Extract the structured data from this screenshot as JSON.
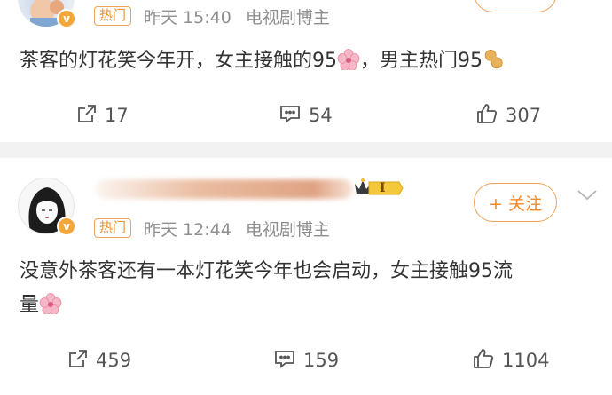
{
  "posts": [
    {
      "tag": "热门",
      "time": "昨天 15:40",
      "source": "电视剧博主",
      "follow_label": "",
      "content": "茶客的灯花笑今年开，女主接触的95",
      "content_mid": "，男主热门95",
      "repost_count": "17",
      "comment_count": "54",
      "like_count": "307"
    },
    {
      "tag": "热门",
      "time": "昨天 12:44",
      "source": "电视剧博主",
      "follow_label": "+ 关注",
      "level_label": "I",
      "content_line1": "没意外茶客还有一本灯花笑今年也会启动，女主接触95流",
      "content_line2": "量",
      "repost_count": "459",
      "comment_count": "159",
      "like_count": "1104"
    }
  ],
  "icons": {
    "verified": "verified-badge-icon",
    "repost": "repost-icon",
    "comment": "comment-icon",
    "like": "thumbs-up-icon",
    "flower": "cherry-blossom-emoji",
    "peanut": "peanut-emoji",
    "crown": "crown-level-icon",
    "chevron": "chevron-down-icon"
  },
  "colors": {
    "accent": "#f08a2a",
    "hot_tag": "#e8912f",
    "meta_gray": "#8f8f8f",
    "verified": "#f3a63a"
  }
}
